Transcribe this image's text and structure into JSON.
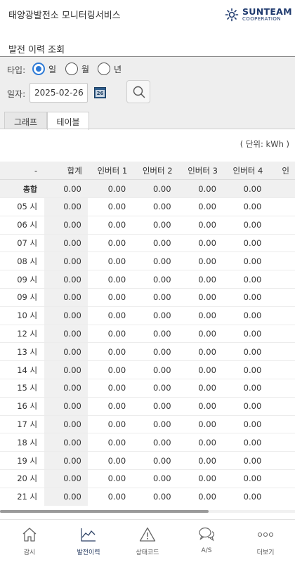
{
  "header": {
    "app_title": "태양광발전소 모니터링서비스",
    "logo_text": "SUNTEAM",
    "logo_sub": "COOPERATION"
  },
  "page_title": "발전 이력 조회",
  "filter": {
    "type_label": "타입:",
    "type_options": [
      "일",
      "월",
      "년"
    ],
    "type_selected": "일",
    "date_label": "일자:",
    "date_value": "2025-02-26",
    "calendar_day": "26"
  },
  "tabs": [
    "그래프",
    "테이블"
  ],
  "active_tab": "테이블",
  "unit": "( 단위: kWh )",
  "table": {
    "columns": [
      "-",
      "합계",
      "인버터 1",
      "인버터 2",
      "인버터 3",
      "인버터 4",
      "인"
    ],
    "total": {
      "label": "총합",
      "values": [
        "0.00",
        "0.00",
        "0.00",
        "0.00",
        "0.00",
        ""
      ]
    },
    "rows": [
      {
        "hour": "05 시",
        "values": [
          "0.00",
          "0.00",
          "0.00",
          "0.00",
          "0.00",
          ""
        ]
      },
      {
        "hour": "06 시",
        "values": [
          "0.00",
          "0.00",
          "0.00",
          "0.00",
          "0.00",
          ""
        ]
      },
      {
        "hour": "07 시",
        "values": [
          "0.00",
          "0.00",
          "0.00",
          "0.00",
          "0.00",
          ""
        ]
      },
      {
        "hour": "08 시",
        "values": [
          "0.00",
          "0.00",
          "0.00",
          "0.00",
          "0.00",
          ""
        ]
      },
      {
        "hour": "09 시",
        "values": [
          "0.00",
          "0.00",
          "0.00",
          "0.00",
          "0.00",
          ""
        ]
      },
      {
        "hour": "09 시",
        "values": [
          "0.00",
          "0.00",
          "0.00",
          "0.00",
          "0.00",
          ""
        ]
      },
      {
        "hour": "10 시",
        "values": [
          "0.00",
          "0.00",
          "0.00",
          "0.00",
          "0.00",
          ""
        ]
      },
      {
        "hour": "12 시",
        "values": [
          "0.00",
          "0.00",
          "0.00",
          "0.00",
          "0.00",
          ""
        ]
      },
      {
        "hour": "13 시",
        "values": [
          "0.00",
          "0.00",
          "0.00",
          "0.00",
          "0.00",
          ""
        ]
      },
      {
        "hour": "14 시",
        "values": [
          "0.00",
          "0.00",
          "0.00",
          "0.00",
          "0.00",
          ""
        ]
      },
      {
        "hour": "15 시",
        "values": [
          "0.00",
          "0.00",
          "0.00",
          "0.00",
          "0.00",
          ""
        ]
      },
      {
        "hour": "16 시",
        "values": [
          "0.00",
          "0.00",
          "0.00",
          "0.00",
          "0.00",
          ""
        ]
      },
      {
        "hour": "17 시",
        "values": [
          "0.00",
          "0.00",
          "0.00",
          "0.00",
          "0.00",
          ""
        ]
      },
      {
        "hour": "18 시",
        "values": [
          "0.00",
          "0.00",
          "0.00",
          "0.00",
          "0.00",
          ""
        ]
      },
      {
        "hour": "19 시",
        "values": [
          "0.00",
          "0.00",
          "0.00",
          "0.00",
          "0.00",
          ""
        ]
      },
      {
        "hour": "20 시",
        "values": [
          "0.00",
          "0.00",
          "0.00",
          "0.00",
          "0.00",
          ""
        ]
      },
      {
        "hour": "21 시",
        "values": [
          "0.00",
          "0.00",
          "0.00",
          "0.00",
          "0.00",
          ""
        ]
      }
    ]
  },
  "bottom_nav": [
    {
      "label": "감시",
      "icon": "home-icon"
    },
    {
      "label": "발전이력",
      "icon": "line-chart-icon"
    },
    {
      "label": "상태코드",
      "icon": "warning-icon"
    },
    {
      "label": "A/S",
      "icon": "chat-bubbles-icon"
    },
    {
      "label": "더보기",
      "icon": "more-icon"
    }
  ],
  "active_nav": "발전이력",
  "colors": {
    "accent": "#2d7ad6",
    "brand": "#1f3a6e",
    "panel_bg": "#eeeeee"
  }
}
